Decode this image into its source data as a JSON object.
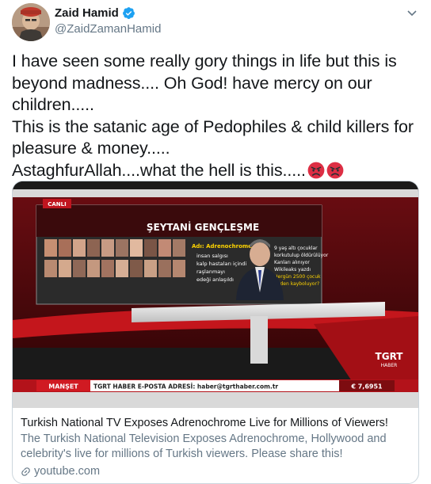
{
  "author": {
    "name": "Zaid Hamid",
    "handle": "@ZaidZamanHamid",
    "verified": true
  },
  "tweet": {
    "lines": [
      "I have seen some really gory things in life but this is beyond madness.... Oh God! have mercy on our children.....",
      "This is the satanic age of Pedophiles & child killers for pleasure & money.....",
      "AstaghfurAllah....what the hell is this....."
    ],
    "emoji": [
      "angry-face",
      "angry-face"
    ]
  },
  "card": {
    "title": "Turkish National TV Exposes Adrenochrome Live for Millions of Viewers!",
    "description": "The Turkish National Television Exposes Adrenochrome, Hollywood and celebrity's live for millions of Turkish viewers. Please share this!",
    "domain": "youtube.com",
    "media": {
      "live_badge": "CANLI",
      "screen_title": "ŞEYTANİ GENÇLEŞME",
      "screen_label": "Adı: Adrenochrome",
      "screen_lines_left": [
        "insan salgısı",
        "kalp hastaları içindi",
        "raşlanmayı",
        "edeği anlaşıldı"
      ],
      "screen_lines_right": [
        "9 yaş altı çocuklar",
        "korkutulup öldürülüyor",
        "Kanları alınıyor",
        "Wikileaks yazdı",
        "Hergün 2500 çocuk",
        "neden kayboluyor?"
      ],
      "channel_logo": "TGRT",
      "channel_logo_sub": "HABER",
      "ticker_label": "MANŞET",
      "ticker_text": "TGRT HABER E-POSTA ADRESİ: haber@tgrthaber.com.tr",
      "ticker_value": "€ 7,6951"
    }
  }
}
